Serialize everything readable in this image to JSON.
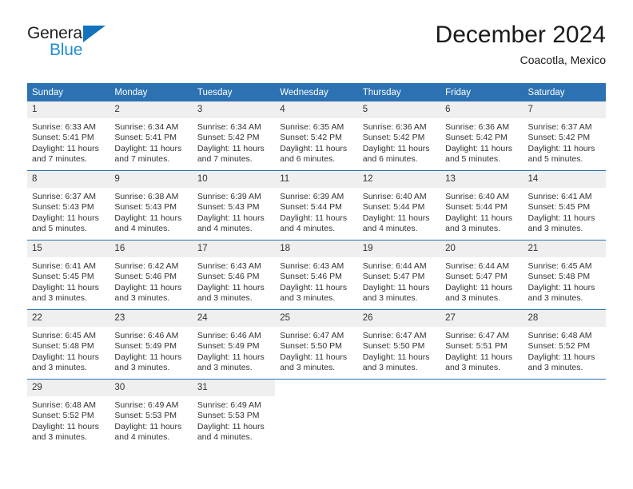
{
  "logo": {
    "text_primary": "General",
    "text_secondary": "Blue",
    "icon": "triangle-logo-icon",
    "color_primary": "#231f20",
    "color_secondary": "#1e8fd5",
    "triangle_color": "#1272bb"
  },
  "header": {
    "title": "December 2024",
    "subtitle": "Coacotla, Mexico"
  },
  "theme": {
    "header_blue": "#2c72b3",
    "daynum_gray": "#efefef",
    "text": "#333333"
  },
  "weekday_headers": [
    "Sunday",
    "Monday",
    "Tuesday",
    "Wednesday",
    "Thursday",
    "Friday",
    "Saturday"
  ],
  "weeks": [
    [
      {
        "day": "1",
        "sunrise": "Sunrise: 6:33 AM",
        "sunset": "Sunset: 5:41 PM",
        "daylight1": "Daylight: 11 hours",
        "daylight2": "and 7 minutes."
      },
      {
        "day": "2",
        "sunrise": "Sunrise: 6:34 AM",
        "sunset": "Sunset: 5:41 PM",
        "daylight1": "Daylight: 11 hours",
        "daylight2": "and 7 minutes."
      },
      {
        "day": "3",
        "sunrise": "Sunrise: 6:34 AM",
        "sunset": "Sunset: 5:42 PM",
        "daylight1": "Daylight: 11 hours",
        "daylight2": "and 7 minutes."
      },
      {
        "day": "4",
        "sunrise": "Sunrise: 6:35 AM",
        "sunset": "Sunset: 5:42 PM",
        "daylight1": "Daylight: 11 hours",
        "daylight2": "and 6 minutes."
      },
      {
        "day": "5",
        "sunrise": "Sunrise: 6:36 AM",
        "sunset": "Sunset: 5:42 PM",
        "daylight1": "Daylight: 11 hours",
        "daylight2": "and 6 minutes."
      },
      {
        "day": "6",
        "sunrise": "Sunrise: 6:36 AM",
        "sunset": "Sunset: 5:42 PM",
        "daylight1": "Daylight: 11 hours",
        "daylight2": "and 5 minutes."
      },
      {
        "day": "7",
        "sunrise": "Sunrise: 6:37 AM",
        "sunset": "Sunset: 5:42 PM",
        "daylight1": "Daylight: 11 hours",
        "daylight2": "and 5 minutes."
      }
    ],
    [
      {
        "day": "8",
        "sunrise": "Sunrise: 6:37 AM",
        "sunset": "Sunset: 5:43 PM",
        "daylight1": "Daylight: 11 hours",
        "daylight2": "and 5 minutes."
      },
      {
        "day": "9",
        "sunrise": "Sunrise: 6:38 AM",
        "sunset": "Sunset: 5:43 PM",
        "daylight1": "Daylight: 11 hours",
        "daylight2": "and 4 minutes."
      },
      {
        "day": "10",
        "sunrise": "Sunrise: 6:39 AM",
        "sunset": "Sunset: 5:43 PM",
        "daylight1": "Daylight: 11 hours",
        "daylight2": "and 4 minutes."
      },
      {
        "day": "11",
        "sunrise": "Sunrise: 6:39 AM",
        "sunset": "Sunset: 5:44 PM",
        "daylight1": "Daylight: 11 hours",
        "daylight2": "and 4 minutes."
      },
      {
        "day": "12",
        "sunrise": "Sunrise: 6:40 AM",
        "sunset": "Sunset: 5:44 PM",
        "daylight1": "Daylight: 11 hours",
        "daylight2": "and 4 minutes."
      },
      {
        "day": "13",
        "sunrise": "Sunrise: 6:40 AM",
        "sunset": "Sunset: 5:44 PM",
        "daylight1": "Daylight: 11 hours",
        "daylight2": "and 3 minutes."
      },
      {
        "day": "14",
        "sunrise": "Sunrise: 6:41 AM",
        "sunset": "Sunset: 5:45 PM",
        "daylight1": "Daylight: 11 hours",
        "daylight2": "and 3 minutes."
      }
    ],
    [
      {
        "day": "15",
        "sunrise": "Sunrise: 6:41 AM",
        "sunset": "Sunset: 5:45 PM",
        "daylight1": "Daylight: 11 hours",
        "daylight2": "and 3 minutes."
      },
      {
        "day": "16",
        "sunrise": "Sunrise: 6:42 AM",
        "sunset": "Sunset: 5:46 PM",
        "daylight1": "Daylight: 11 hours",
        "daylight2": "and 3 minutes."
      },
      {
        "day": "17",
        "sunrise": "Sunrise: 6:43 AM",
        "sunset": "Sunset: 5:46 PM",
        "daylight1": "Daylight: 11 hours",
        "daylight2": "and 3 minutes."
      },
      {
        "day": "18",
        "sunrise": "Sunrise: 6:43 AM",
        "sunset": "Sunset: 5:46 PM",
        "daylight1": "Daylight: 11 hours",
        "daylight2": "and 3 minutes."
      },
      {
        "day": "19",
        "sunrise": "Sunrise: 6:44 AM",
        "sunset": "Sunset: 5:47 PM",
        "daylight1": "Daylight: 11 hours",
        "daylight2": "and 3 minutes."
      },
      {
        "day": "20",
        "sunrise": "Sunrise: 6:44 AM",
        "sunset": "Sunset: 5:47 PM",
        "daylight1": "Daylight: 11 hours",
        "daylight2": "and 3 minutes."
      },
      {
        "day": "21",
        "sunrise": "Sunrise: 6:45 AM",
        "sunset": "Sunset: 5:48 PM",
        "daylight1": "Daylight: 11 hours",
        "daylight2": "and 3 minutes."
      }
    ],
    [
      {
        "day": "22",
        "sunrise": "Sunrise: 6:45 AM",
        "sunset": "Sunset: 5:48 PM",
        "daylight1": "Daylight: 11 hours",
        "daylight2": "and 3 minutes."
      },
      {
        "day": "23",
        "sunrise": "Sunrise: 6:46 AM",
        "sunset": "Sunset: 5:49 PM",
        "daylight1": "Daylight: 11 hours",
        "daylight2": "and 3 minutes."
      },
      {
        "day": "24",
        "sunrise": "Sunrise: 6:46 AM",
        "sunset": "Sunset: 5:49 PM",
        "daylight1": "Daylight: 11 hours",
        "daylight2": "and 3 minutes."
      },
      {
        "day": "25",
        "sunrise": "Sunrise: 6:47 AM",
        "sunset": "Sunset: 5:50 PM",
        "daylight1": "Daylight: 11 hours",
        "daylight2": "and 3 minutes."
      },
      {
        "day": "26",
        "sunrise": "Sunrise: 6:47 AM",
        "sunset": "Sunset: 5:50 PM",
        "daylight1": "Daylight: 11 hours",
        "daylight2": "and 3 minutes."
      },
      {
        "day": "27",
        "sunrise": "Sunrise: 6:47 AM",
        "sunset": "Sunset: 5:51 PM",
        "daylight1": "Daylight: 11 hours",
        "daylight2": "and 3 minutes."
      },
      {
        "day": "28",
        "sunrise": "Sunrise: 6:48 AM",
        "sunset": "Sunset: 5:52 PM",
        "daylight1": "Daylight: 11 hours",
        "daylight2": "and 3 minutes."
      }
    ],
    [
      {
        "day": "29",
        "sunrise": "Sunrise: 6:48 AM",
        "sunset": "Sunset: 5:52 PM",
        "daylight1": "Daylight: 11 hours",
        "daylight2": "and 3 minutes."
      },
      {
        "day": "30",
        "sunrise": "Sunrise: 6:49 AM",
        "sunset": "Sunset: 5:53 PM",
        "daylight1": "Daylight: 11 hours",
        "daylight2": "and 4 minutes."
      },
      {
        "day": "31",
        "sunrise": "Sunrise: 6:49 AM",
        "sunset": "Sunset: 5:53 PM",
        "daylight1": "Daylight: 11 hours",
        "daylight2": "and 4 minutes."
      },
      {
        "day": "",
        "sunrise": "",
        "sunset": "",
        "daylight1": "",
        "daylight2": ""
      },
      {
        "day": "",
        "sunrise": "",
        "sunset": "",
        "daylight1": "",
        "daylight2": ""
      },
      {
        "day": "",
        "sunrise": "",
        "sunset": "",
        "daylight1": "",
        "daylight2": ""
      },
      {
        "day": "",
        "sunrise": "",
        "sunset": "",
        "daylight1": "",
        "daylight2": ""
      }
    ]
  ]
}
